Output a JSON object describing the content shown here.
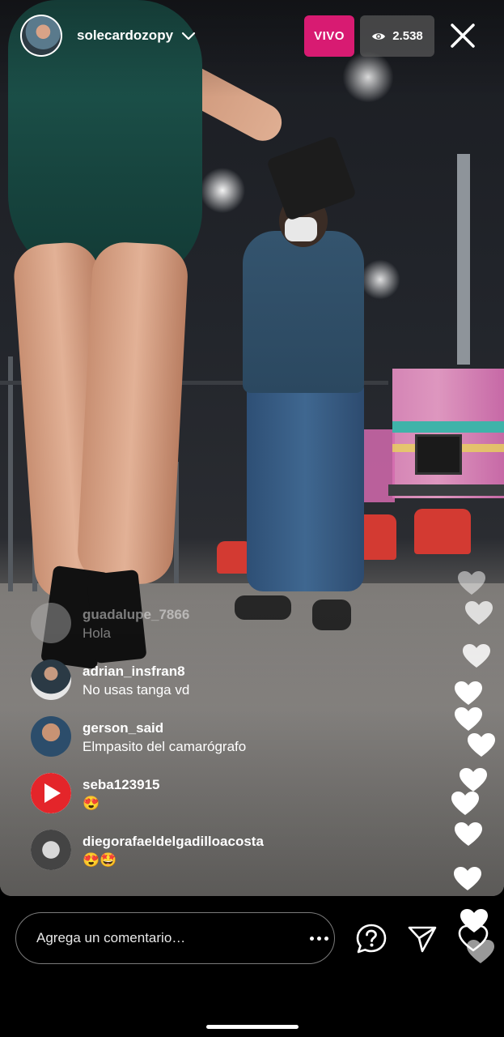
{
  "header": {
    "username": "solecardozopy",
    "live_label": "VIVO",
    "viewer_count": "2.538",
    "icons": [
      "profile-avatar",
      "chevron-down-icon",
      "eye-icon",
      "close-icon"
    ]
  },
  "comments": [
    {
      "user": "guadalupe_7866",
      "message": "Hola"
    },
    {
      "user": "adrian_insfran8",
      "message": "No usas tanga vd"
    },
    {
      "user": "gerson_said",
      "message": "Elmpasito del camarógrafo"
    },
    {
      "user": "seba123915",
      "message": "😍"
    },
    {
      "user": "diegorafaeldelgadilloacosta",
      "message": "😍🤩"
    }
  ],
  "composer": {
    "placeholder": "Agrega un comentario…",
    "icons": [
      "more-options-icon",
      "question-icon",
      "send-icon",
      "heart-icon"
    ]
  },
  "colors": {
    "live_badge": "#d81b72",
    "viewer_badge": "#5a5a5a",
    "background": "#000000"
  }
}
